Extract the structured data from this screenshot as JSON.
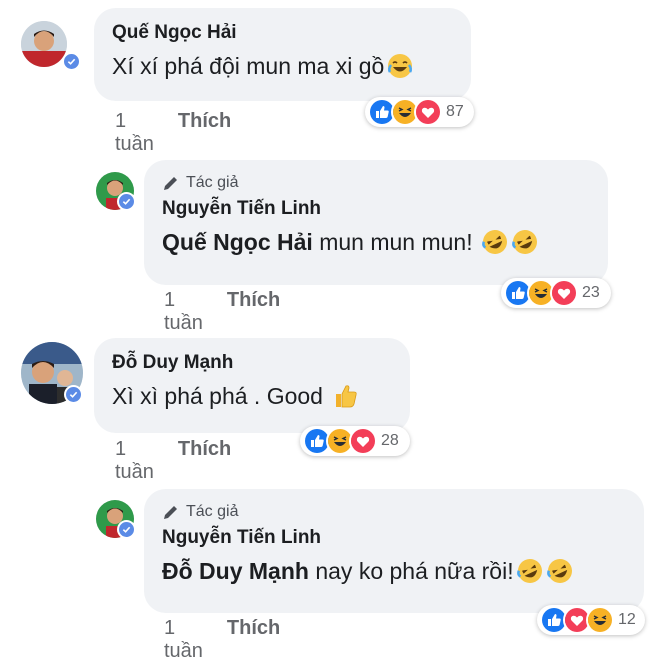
{
  "comments": [
    {
      "author": "Quế Ngọc Hải",
      "text": "Xí xí phá đội mun ma xi gồ",
      "time": "1 tuần",
      "like": "Thích",
      "reaction_count": "87",
      "reactions": [
        "like-icon",
        "haha-icon",
        "love-icon"
      ],
      "trailing_emoji": [
        "laughing-tears-emoji-icon"
      ]
    },
    {
      "author_tag": "Tác giả",
      "author": "Nguyễn Tiến Linh",
      "mention": "Quế Ngọc Hải",
      "text": "mun mun mun!",
      "time": "1 tuần",
      "like": "Thích",
      "reaction_count": "23",
      "reactions": [
        "like-icon",
        "haha-icon",
        "love-icon"
      ],
      "trailing_emoji": [
        "rofl-emoji-icon",
        "rofl-emoji-icon"
      ]
    },
    {
      "author": "Đỗ Duy Mạnh",
      "text": "Xì xì phá phá . Good",
      "time": "1 tuần",
      "like": "Thích",
      "reaction_count": "28",
      "reactions": [
        "like-icon",
        "haha-icon",
        "love-icon"
      ],
      "trailing_emoji": [
        "thumbs-up-emoji-icon"
      ]
    },
    {
      "author_tag": "Tác giả",
      "author": "Nguyễn Tiến Linh",
      "mention": "Đỗ Duy Mạnh",
      "text": "nay ko phá nữa rồi!",
      "time": "1 tuần",
      "like": "Thích",
      "reaction_count": "12",
      "reactions": [
        "like-icon",
        "love-icon",
        "haha-icon"
      ],
      "trailing_emoji": [
        "rofl-emoji-icon",
        "rofl-emoji-icon"
      ]
    }
  ],
  "colors": {
    "bubble": "#f0f2f5",
    "verified": "#5b8be6",
    "like": "#1877f2",
    "love": "#f33e58",
    "haha": "#f7b125",
    "meta_text": "#65676b"
  }
}
